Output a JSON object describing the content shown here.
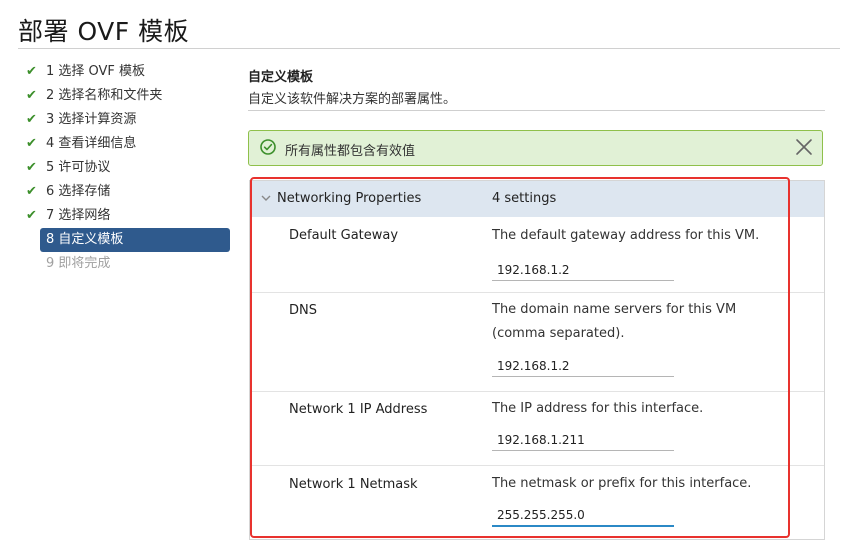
{
  "page": {
    "title": "部署 OVF 模板"
  },
  "steps": [
    {
      "label": "1 选择 OVF 模板",
      "state": "done"
    },
    {
      "label": "2 选择名称和文件夹",
      "state": "done"
    },
    {
      "label": "3 选择计算资源",
      "state": "done"
    },
    {
      "label": "4 查看详细信息",
      "state": "done"
    },
    {
      "label": "5 许可协议",
      "state": "done"
    },
    {
      "label": "6 选择存储",
      "state": "done"
    },
    {
      "label": "7 选择网络",
      "state": "done"
    },
    {
      "label": "8 自定义模板",
      "state": "active"
    },
    {
      "label": "9 即将完成",
      "state": "disabled"
    }
  ],
  "section": {
    "title": "自定义模板",
    "description": "自定义该软件解决方案的部署属性。"
  },
  "alert": {
    "message": "所有属性都包含有效值",
    "icon": "check-circle-icon"
  },
  "group": {
    "name": "Networking Properties",
    "count": "4 settings"
  },
  "properties": [
    {
      "label": "Default Gateway",
      "description": "The default gateway address for this VM.",
      "value": "192.168.1.2"
    },
    {
      "label": "DNS",
      "description": "The domain name servers for this VM (comma separated).",
      "value": "192.168.1.2"
    },
    {
      "label": "Network 1 IP Address",
      "description": "The IP address for this interface.",
      "value": "192.168.1.211"
    },
    {
      "label": "Network 1 Netmask",
      "description": "The netmask or prefix for this interface.",
      "value": "255.255.255.0"
    }
  ],
  "colors": {
    "accent": "#2f5a8d",
    "success": "#3c8f2b",
    "alert_bg": "#e1f1d6",
    "highlight": "#e8322e"
  }
}
